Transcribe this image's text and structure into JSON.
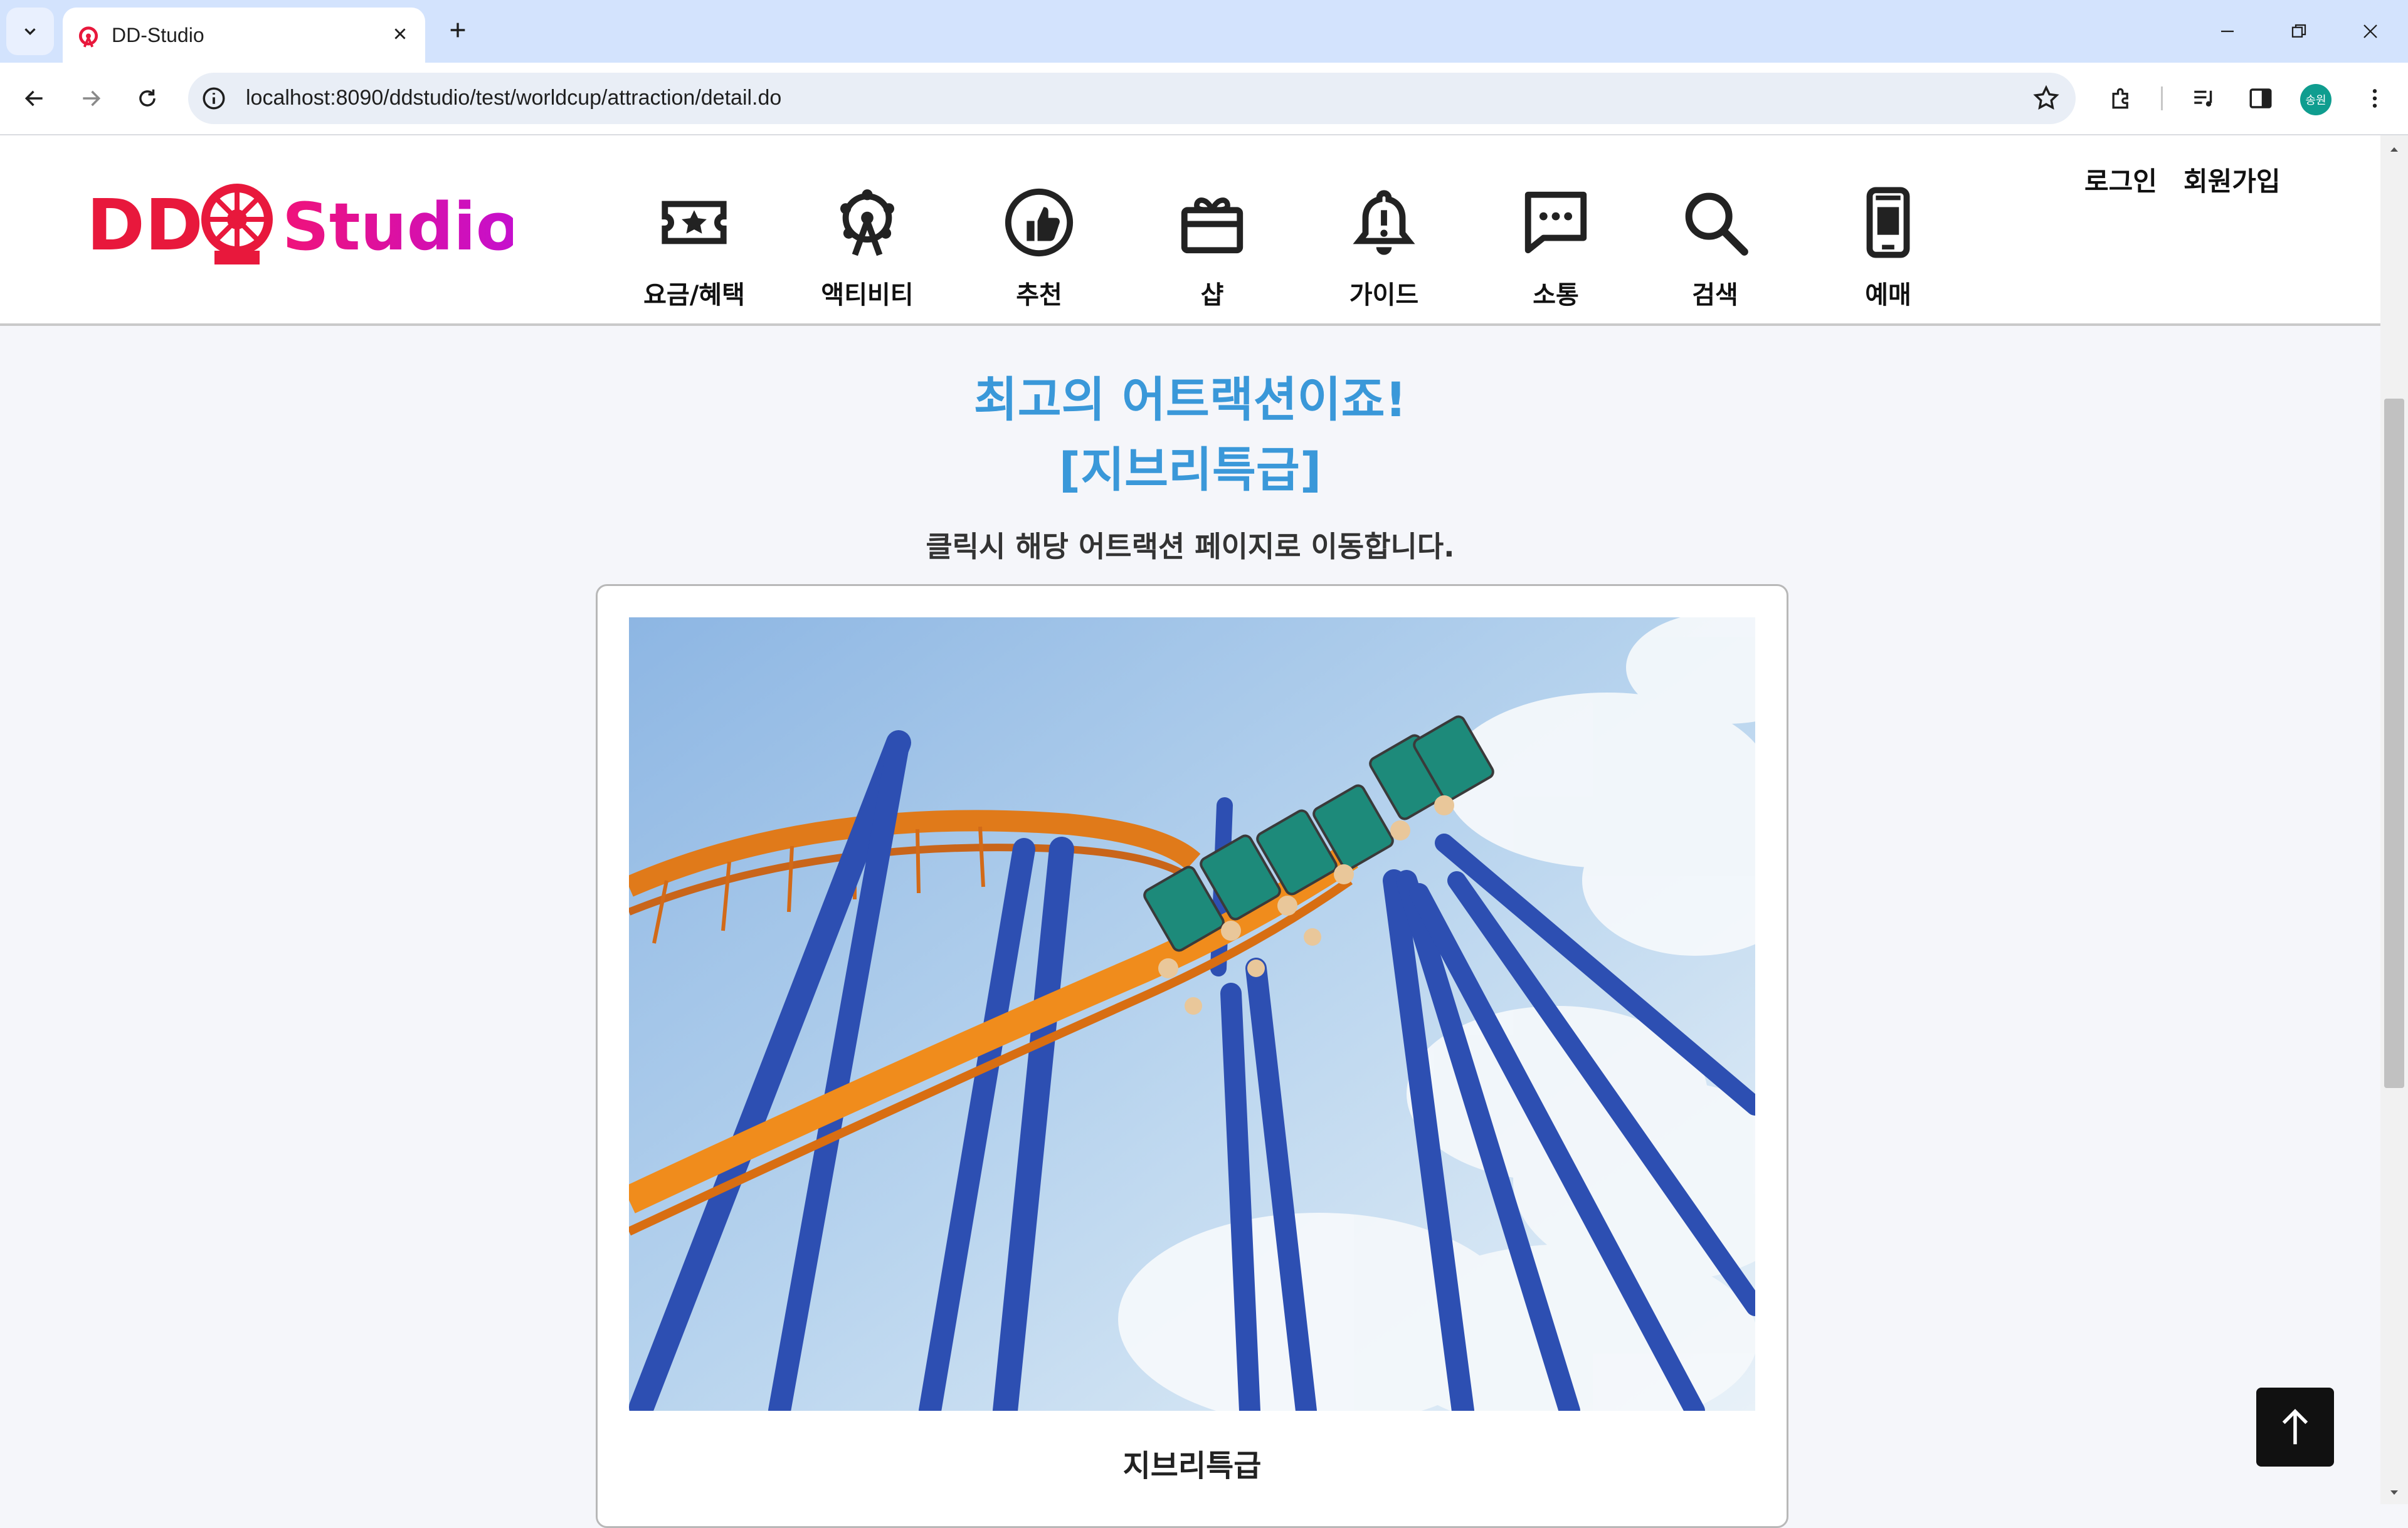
{
  "browser": {
    "tab_title": "DD-Studio",
    "url": "localhost:8090/ddstudio/test/worldcup/attraction/detail.do",
    "profile_initials": "송원"
  },
  "site": {
    "logo_text": "DD Studio",
    "menu": [
      {
        "label": "요금/혜택",
        "icon": "ticket-icon"
      },
      {
        "label": "액티비티",
        "icon": "ferris-wheel-icon"
      },
      {
        "label": "추천",
        "icon": "thumbs-up-icon"
      },
      {
        "label": "샵",
        "icon": "gift-icon"
      },
      {
        "label": "가이드",
        "icon": "bell-alert-icon"
      },
      {
        "label": "소통",
        "icon": "chat-icon"
      },
      {
        "label": "검색",
        "icon": "search-icon"
      },
      {
        "label": "예매",
        "icon": "mobile-ticket-icon"
      }
    ],
    "auth": {
      "login": "로그인",
      "signup": "회원가입"
    }
  },
  "main": {
    "headline_line1": "최고의 어트랙션이죠!",
    "headline_line2": "[지브리특급]",
    "subtitle": "클릭시 해당 어트랙션 페이지로 이동합니다.",
    "attraction_name": "지브리특급"
  },
  "colors": {
    "headline": "#3a98d9",
    "logo_red": "#e8183c",
    "logo_magenta": "#c40fd0",
    "tabbar": "#d3e3fd"
  }
}
